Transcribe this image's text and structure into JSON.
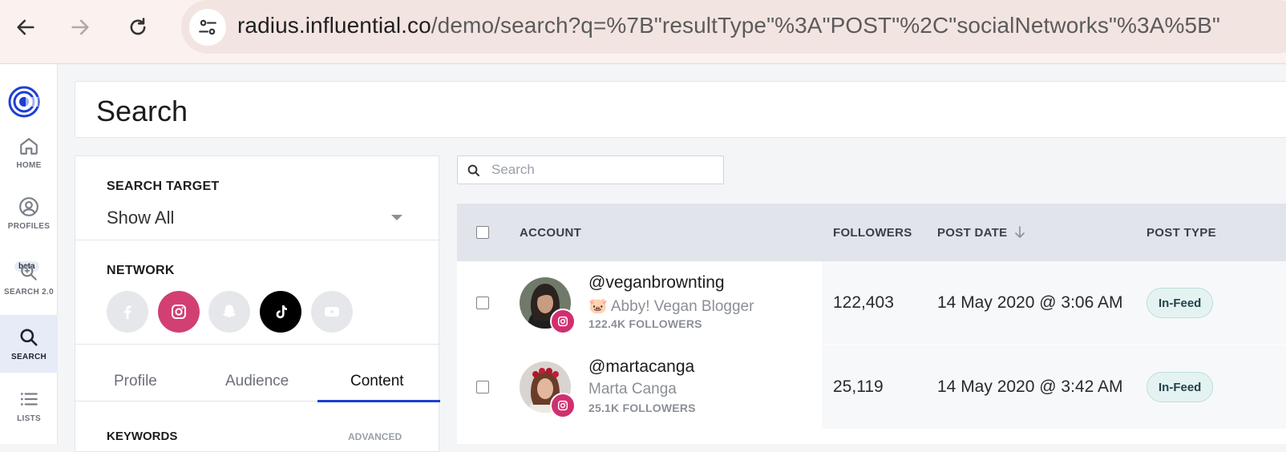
{
  "browser": {
    "url_host": "radius.influential.co",
    "url_path": "/demo/search?q=%7B\"resultType\"%3A\"POST\"%2C\"socialNetworks\"%3A%5B\""
  },
  "sidebar": {
    "items": [
      {
        "label": "HOME",
        "icon": "home-icon"
      },
      {
        "label": "PROFILES",
        "icon": "profile-icon"
      },
      {
        "label": "SEARCH 2.0",
        "icon": "search-2-icon",
        "badge": "beta"
      },
      {
        "label": "SEARCH",
        "icon": "search-icon",
        "active": true
      },
      {
        "label": "LISTS",
        "icon": "list-icon"
      }
    ]
  },
  "page": {
    "title": "Search"
  },
  "filters": {
    "search_target_label": "SEARCH TARGET",
    "search_target_value": "Show All",
    "network_label": "NETWORK",
    "networks": [
      {
        "name": "facebook",
        "selected": false,
        "color": "#e6e7ea"
      },
      {
        "name": "instagram",
        "selected": true,
        "color": "#d23f73"
      },
      {
        "name": "snapchat",
        "selected": false,
        "color": "#e6e7ea"
      },
      {
        "name": "tiktok",
        "selected": true,
        "color": "#000000"
      },
      {
        "name": "youtube",
        "selected": false,
        "color": "#e6e7ea"
      }
    ],
    "tabs": [
      {
        "label": "Profile"
      },
      {
        "label": "Audience"
      },
      {
        "label": "Content",
        "active": true
      }
    ],
    "keywords_label": "KEYWORDS",
    "advanced_label": "ADVANCED"
  },
  "results": {
    "search_placeholder": "Search",
    "columns": [
      "ACCOUNT",
      "FOLLOWERS",
      "POST DATE",
      "POST TYPE"
    ],
    "rows": [
      {
        "handle": "@veganbrownting",
        "name": "🐷 Abby! Vegan Blogger",
        "followers_short": "122.4K FOLLOWERS",
        "followers": "122,403",
        "post_date": "14 May 2020 @ 3:06 AM",
        "post_type": "In-Feed"
      },
      {
        "handle": "@martacanga",
        "name": "Marta Canga",
        "followers_short": "25.1K FOLLOWERS",
        "followers": "25,119",
        "post_date": "14 May 2020 @ 3:42 AM",
        "post_type": "In-Feed"
      }
    ]
  },
  "colors": {
    "accent": "#1d3fd1",
    "instagram": "#d0306f",
    "badge_bg": "#e4f3f2"
  }
}
